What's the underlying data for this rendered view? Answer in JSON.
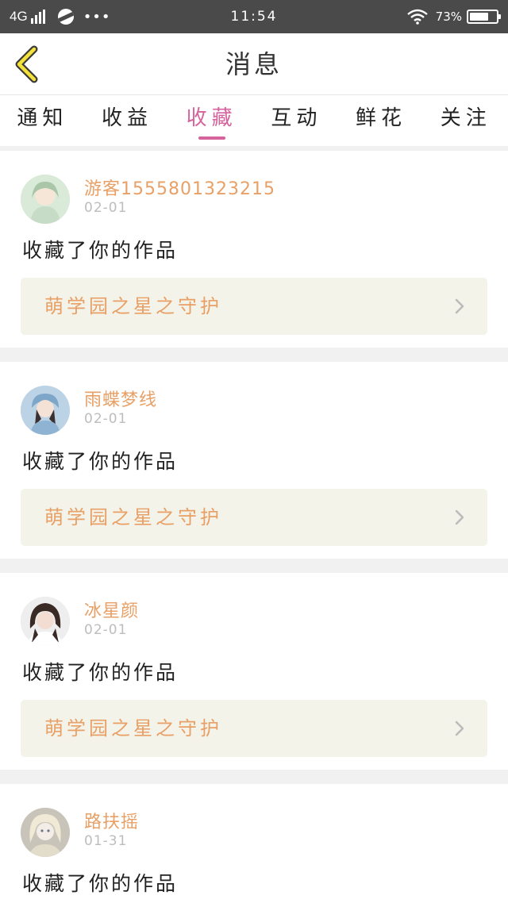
{
  "status_bar": {
    "network": "4G",
    "dots": "•••",
    "time": "11:54",
    "battery_text": "73%",
    "battery_level": 0.73
  },
  "header": {
    "title": "消息"
  },
  "tabs": [
    {
      "label": "通知",
      "active": false
    },
    {
      "label": "收益",
      "active": false
    },
    {
      "label": "收藏",
      "active": true
    },
    {
      "label": "互动",
      "active": false
    },
    {
      "label": "鲜花",
      "active": false
    },
    {
      "label": "关注",
      "active": false
    }
  ],
  "colors": {
    "accent": "#d6639c",
    "name_color": "#e8a066",
    "work_bg": "#f3f3ea"
  },
  "messages": [
    {
      "user": "游客15558013232​15",
      "date": "02-01",
      "action": "收藏了你的作品",
      "work": "萌学园之星之守护"
    },
    {
      "user": "雨蝶梦线",
      "date": "02-01",
      "action": "收藏了你的作品",
      "work": "萌学园之星之守护"
    },
    {
      "user": "冰星颜",
      "date": "02-01",
      "action": "收藏了你的作品",
      "work": "萌学园之星之守护"
    },
    {
      "user": "路扶摇",
      "date": "01-31",
      "action": "收藏了你的作品",
      "work": ""
    }
  ]
}
